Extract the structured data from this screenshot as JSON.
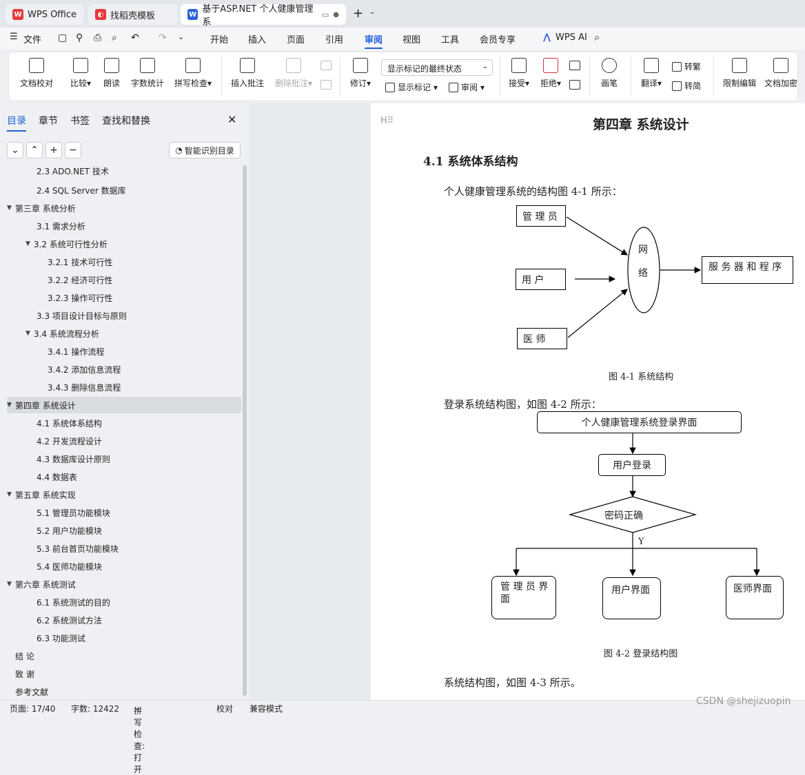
{
  "tabs": [
    {
      "label": "WPS Office"
    },
    {
      "label": "找稻壳模板"
    },
    {
      "label": "基于ASP.NET 个人健康管理系"
    }
  ],
  "menu": {
    "file": "文件",
    "items": [
      "开始",
      "插入",
      "页面",
      "引用",
      "审阅",
      "视图",
      "工具",
      "会员专享"
    ],
    "ai": "WPS AI",
    "active": "审阅"
  },
  "ribbon": {
    "doc_check": "文档校对",
    "compare": "比较",
    "read": "朗读",
    "wordcount": "字数统计",
    "spell": "拼写检查",
    "insert_comment": "插入批注",
    "delete_comment": "删除批注",
    "revise": "修订",
    "markup_select": "显示标记的最终状态",
    "show_markup": "显示标记",
    "review": "审阅",
    "accept": "接受",
    "reject": "拒绝",
    "pen": "画笔",
    "translate": "翻译",
    "to_trad": "转繁",
    "to_simp": "转简",
    "restrict": "限制编辑",
    "encrypt": "文档加密"
  },
  "sidebar": {
    "tabs": [
      "目录",
      "章节",
      "书签",
      "查找和替换"
    ],
    "smart_toc": "智能识别目录",
    "toc": [
      {
        "text": "2.3 ADO.NET 技术",
        "level": 2
      },
      {
        "text": "2.4 SQL Server 数据库",
        "level": 2
      },
      {
        "text": "第三章  系统分析",
        "level": 1,
        "expand": true
      },
      {
        "text": "3.1  需求分析",
        "level": 2
      },
      {
        "text": "3.2  系统可行性分析",
        "level": 2,
        "expand": true
      },
      {
        "text": "3.2.1  技术可行性",
        "level": 3
      },
      {
        "text": "3.2.2  经济可行性",
        "level": 3
      },
      {
        "text": "3.2.3  操作可行性",
        "level": 3
      },
      {
        "text": "3.3  项目设计目标与原则",
        "level": 2
      },
      {
        "text": "3.4 系统流程分析",
        "level": 2,
        "expand": true
      },
      {
        "text": "3.4.1 操作流程",
        "level": 3
      },
      {
        "text": "3.4.2 添加信息流程",
        "level": 3
      },
      {
        "text": "3.4.3 删除信息流程",
        "level": 3
      },
      {
        "text": "第四章  系统设计",
        "level": 1,
        "expand": true,
        "selected": true
      },
      {
        "text": "4.1  系统体系结构",
        "level": 2
      },
      {
        "text": "4.2 开发流程设计",
        "level": 2
      },
      {
        "text": "4.3  数据库设计原则",
        "level": 2
      },
      {
        "text": "4.4  数据表",
        "level": 2
      },
      {
        "text": "第五章  系统实现",
        "level": 1,
        "expand": true
      },
      {
        "text": "5.1 管理员功能模块",
        "level": 2
      },
      {
        "text": "5.2 用户功能模块",
        "level": 2
      },
      {
        "text": "5.3 前台首页功能模块",
        "level": 2
      },
      {
        "text": "5.4 医师功能模块",
        "level": 2
      },
      {
        "text": "第六章  系统测试",
        "level": 1,
        "expand": true
      },
      {
        "text": "6.1 系统测试的目的",
        "level": 2
      },
      {
        "text": "6.2 系统测试方法",
        "level": 2
      },
      {
        "text": "6.3 功能测试",
        "level": 2
      },
      {
        "text": "结    论",
        "level": 1
      },
      {
        "text": "致    谢",
        "level": 1
      },
      {
        "text": "参考文献",
        "level": 1
      }
    ]
  },
  "doc": {
    "heading_marker": "H",
    "chapter": "第四章  系统设计",
    "section": "4.1  系统体系结构",
    "para1": "个人健康管理系统的结构图 4-1 所示：",
    "fig1": {
      "admin": "管 理 员",
      "user": "用      户",
      "doctor": "医      师",
      "net1": "网",
      "net2": "络",
      "server": "服 务 器 和 程 序",
      "caption": "图 4-1  系统结构"
    },
    "para2": "登录系统结构图，如图 4-2 所示：",
    "fig2": {
      "top": "个人健康管理系统登录界面",
      "login": "用户登录",
      "pwd": "密码正确",
      "yes": "Y",
      "admin_ui": "管 理 员 界 面",
      "user_ui": "用户界面",
      "doctor_ui": "医师界面",
      "caption": "图 4-2  登录结构图"
    },
    "para3": "系统结构图，如图 4-3 所示。"
  },
  "status": {
    "page": "页面: 17/40",
    "words": "字数: 12422",
    "spell": "拼写检查: 打开",
    "proof": "校对",
    "compat": "兼容模式"
  },
  "watermark": "CSDN @shejizuopin"
}
